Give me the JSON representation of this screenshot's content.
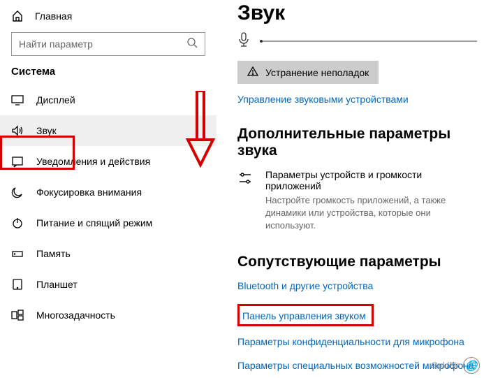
{
  "sidebar": {
    "home_label": "Главная",
    "search_placeholder": "Найти параметр",
    "section_label": "Система",
    "items": [
      {
        "label": "Дисплей"
      },
      {
        "label": "Звук"
      },
      {
        "label": "Уведомления и действия"
      },
      {
        "label": "Фокусировка внимания"
      },
      {
        "label": "Питание и спящий режим"
      },
      {
        "label": "Память"
      },
      {
        "label": "Планшет"
      },
      {
        "label": "Многозадачность"
      }
    ]
  },
  "content": {
    "title": "Звук",
    "troubleshoot_label": "Устранение неполадок",
    "manage_devices_link": "Управление звуковыми устройствами",
    "advanced": {
      "heading": "Дополнительные параметры звука",
      "subtitle": "Параметры устройств и громкости приложений",
      "description": "Настройте громкость приложений, а также динамики или устройства, которые они используют."
    },
    "related": {
      "heading": "Сопутствующие параметры",
      "links": [
        "Bluetooth и другие устройства",
        "Панель управления звуком",
        "Параметры конфиденциальности для микрофона",
        "Параметры специальных возможностей микрофона"
      ]
    }
  },
  "watermark": "GoldBiz"
}
